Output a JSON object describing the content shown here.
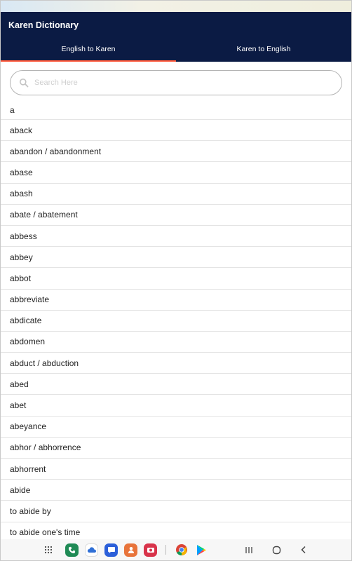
{
  "app": {
    "title": "Karen Dictionary"
  },
  "tabs": [
    {
      "label": "English to Karen",
      "active": true
    },
    {
      "label": "Karen to English",
      "active": false
    }
  ],
  "search": {
    "placeholder": "Search Here",
    "value": ""
  },
  "words": [
    "a",
    "aback",
    "abandon / abandonment",
    "abase",
    "abash",
    "abate / abatement",
    "abbess",
    "abbey",
    "abbot",
    "abbreviate",
    "abdicate",
    "abdomen",
    "abduct / abduction",
    "abed",
    "abet",
    "abeyance",
    "abhor / abhorrence",
    "abhorrent",
    "abide",
    "to abide by",
    "to abide one's time"
  ],
  "colors": {
    "app_bar": "#0b1b44",
    "tab_indicator": "#ff5a3c"
  },
  "system_nav": {
    "apps": [
      {
        "name": "app-drawer-icon"
      },
      {
        "name": "phone-icon",
        "color": "#1f8a55"
      },
      {
        "name": "cloud-icon",
        "color": "#2f6fd6"
      },
      {
        "name": "messages-icon",
        "color": "#2b5fd9"
      },
      {
        "name": "contacts-icon",
        "color": "#e8743b"
      },
      {
        "name": "camera-icon",
        "color": "#d8334a"
      },
      {
        "name": "chrome-icon"
      },
      {
        "name": "play-store-icon"
      }
    ]
  }
}
